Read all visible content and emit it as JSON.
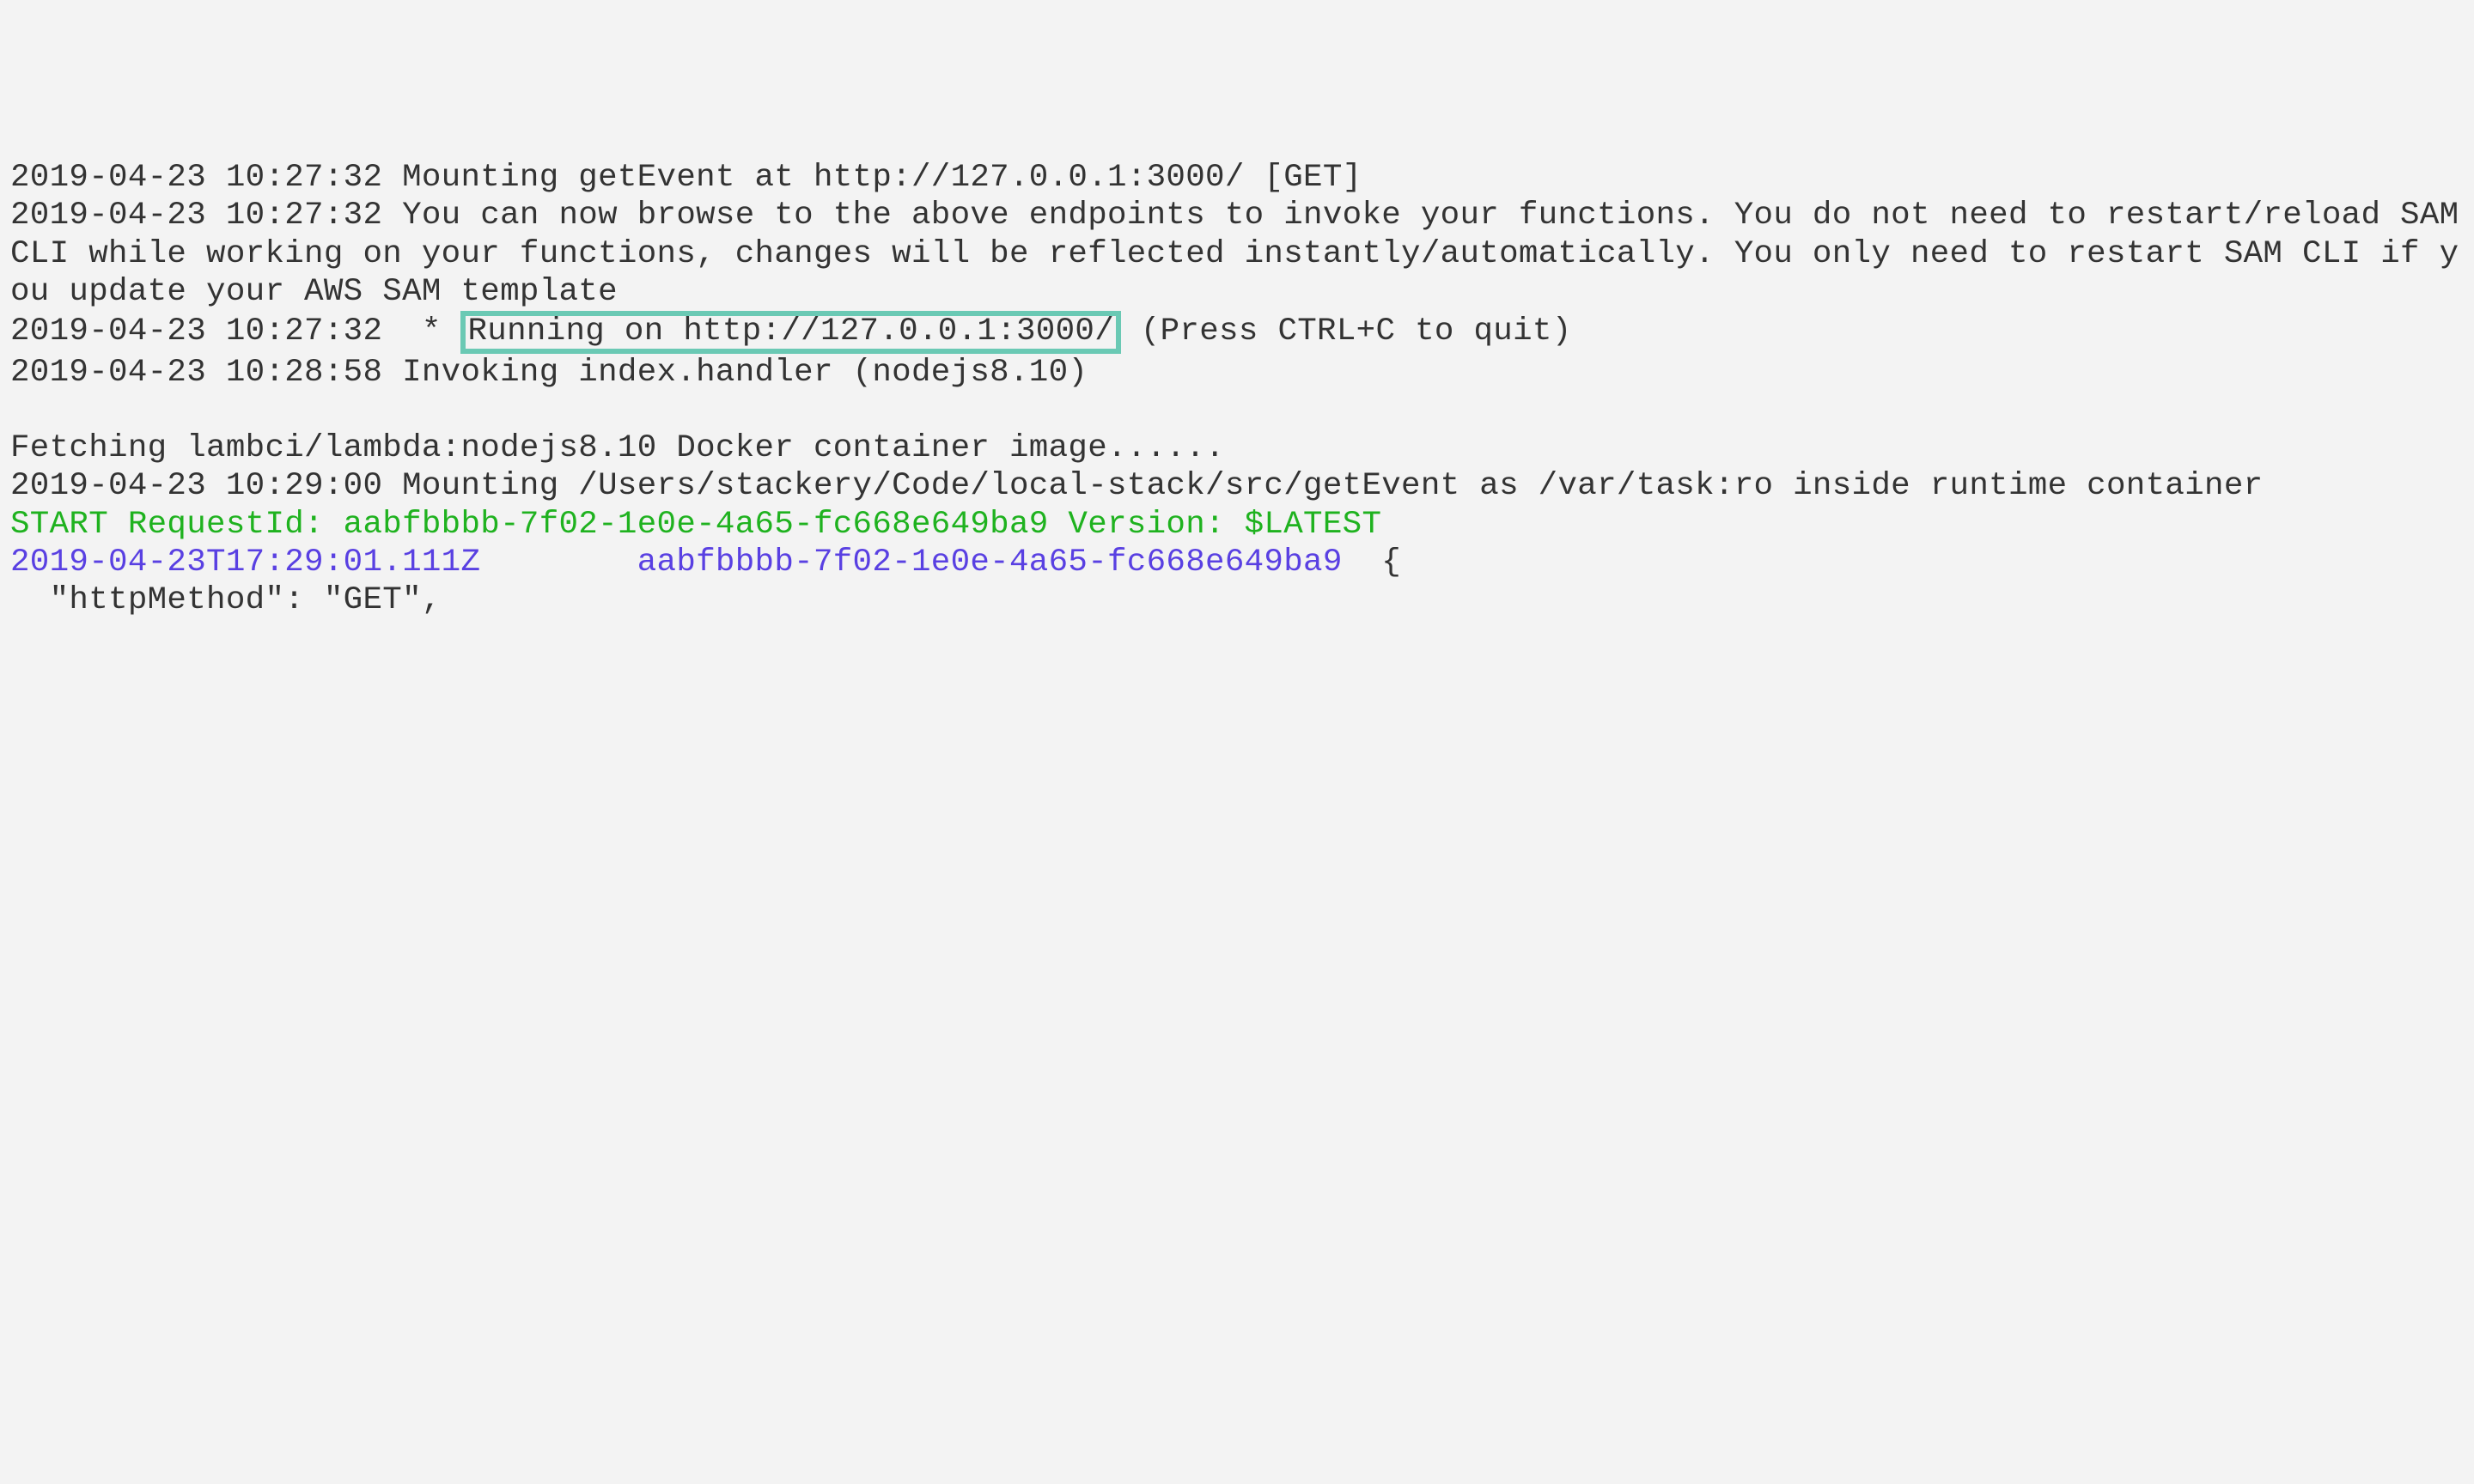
{
  "terminal": {
    "line1": "2019-04-23 10:27:32 Mounting getEvent at http://127.0.0.1:3000/ [GET]",
    "line2": "2019-04-23 10:27:32 You can now browse to the above endpoints to invoke your functions. You do not need to restart/reload SAM CLI while working on your functions, changes will be reflected instantly/automatically. You only need to restart SAM CLI if you update your AWS SAM template",
    "line3_prefix": "2019-04-23 10:27:32  * ",
    "line3_highlight": "Running on http://127.0.0.1:3000/",
    "line3_suffix": " (Press CTRL+C to quit)",
    "line4": "2019-04-23 10:28:58 Invoking index.handler (nodejs8.10)",
    "blank": "",
    "line5": "Fetching lambci/lambda:nodejs8.10 Docker container image......",
    "line6": "2019-04-23 10:29:00 Mounting /Users/stackery/Code/local-stack/src/getEvent as /var/task:ro inside runtime container",
    "line7_green": "START RequestId: aabfbbbb-7f02-1e0e-4a65-fc668e649ba9 Version: $LATEST",
    "line8_purple": "2019-04-23T17:29:01.111Z        aabfbbbb-7f02-1e0e-4a65-fc668e649ba9",
    "line8_black_open": "  {",
    "line9": "  \"httpMethod\": \"GET\","
  }
}
